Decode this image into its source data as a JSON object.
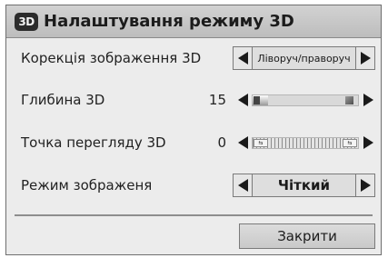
{
  "dialog": {
    "icon_label": "3D",
    "title": "Налаштування режиму 3D",
    "close_label": "Закрити"
  },
  "settings": {
    "correction": {
      "label": "Корекція зображення 3D",
      "selected": "Ліворуч/праворуч"
    },
    "depth": {
      "label": "Глибина 3D",
      "value": "15",
      "fraction": 0.15
    },
    "viewpoint": {
      "label": "Точка перегляду 3D",
      "value": "0"
    },
    "picture_mode": {
      "label": "Режим зображеня",
      "selected": "Чіткий"
    }
  },
  "colors": {
    "titlebar": "#c7c7c7",
    "panel": "#ececec",
    "text": "#1a1a1a"
  },
  "icons": [
    "3d-icon",
    "arrow-left-icon",
    "arrow-right-icon"
  ]
}
